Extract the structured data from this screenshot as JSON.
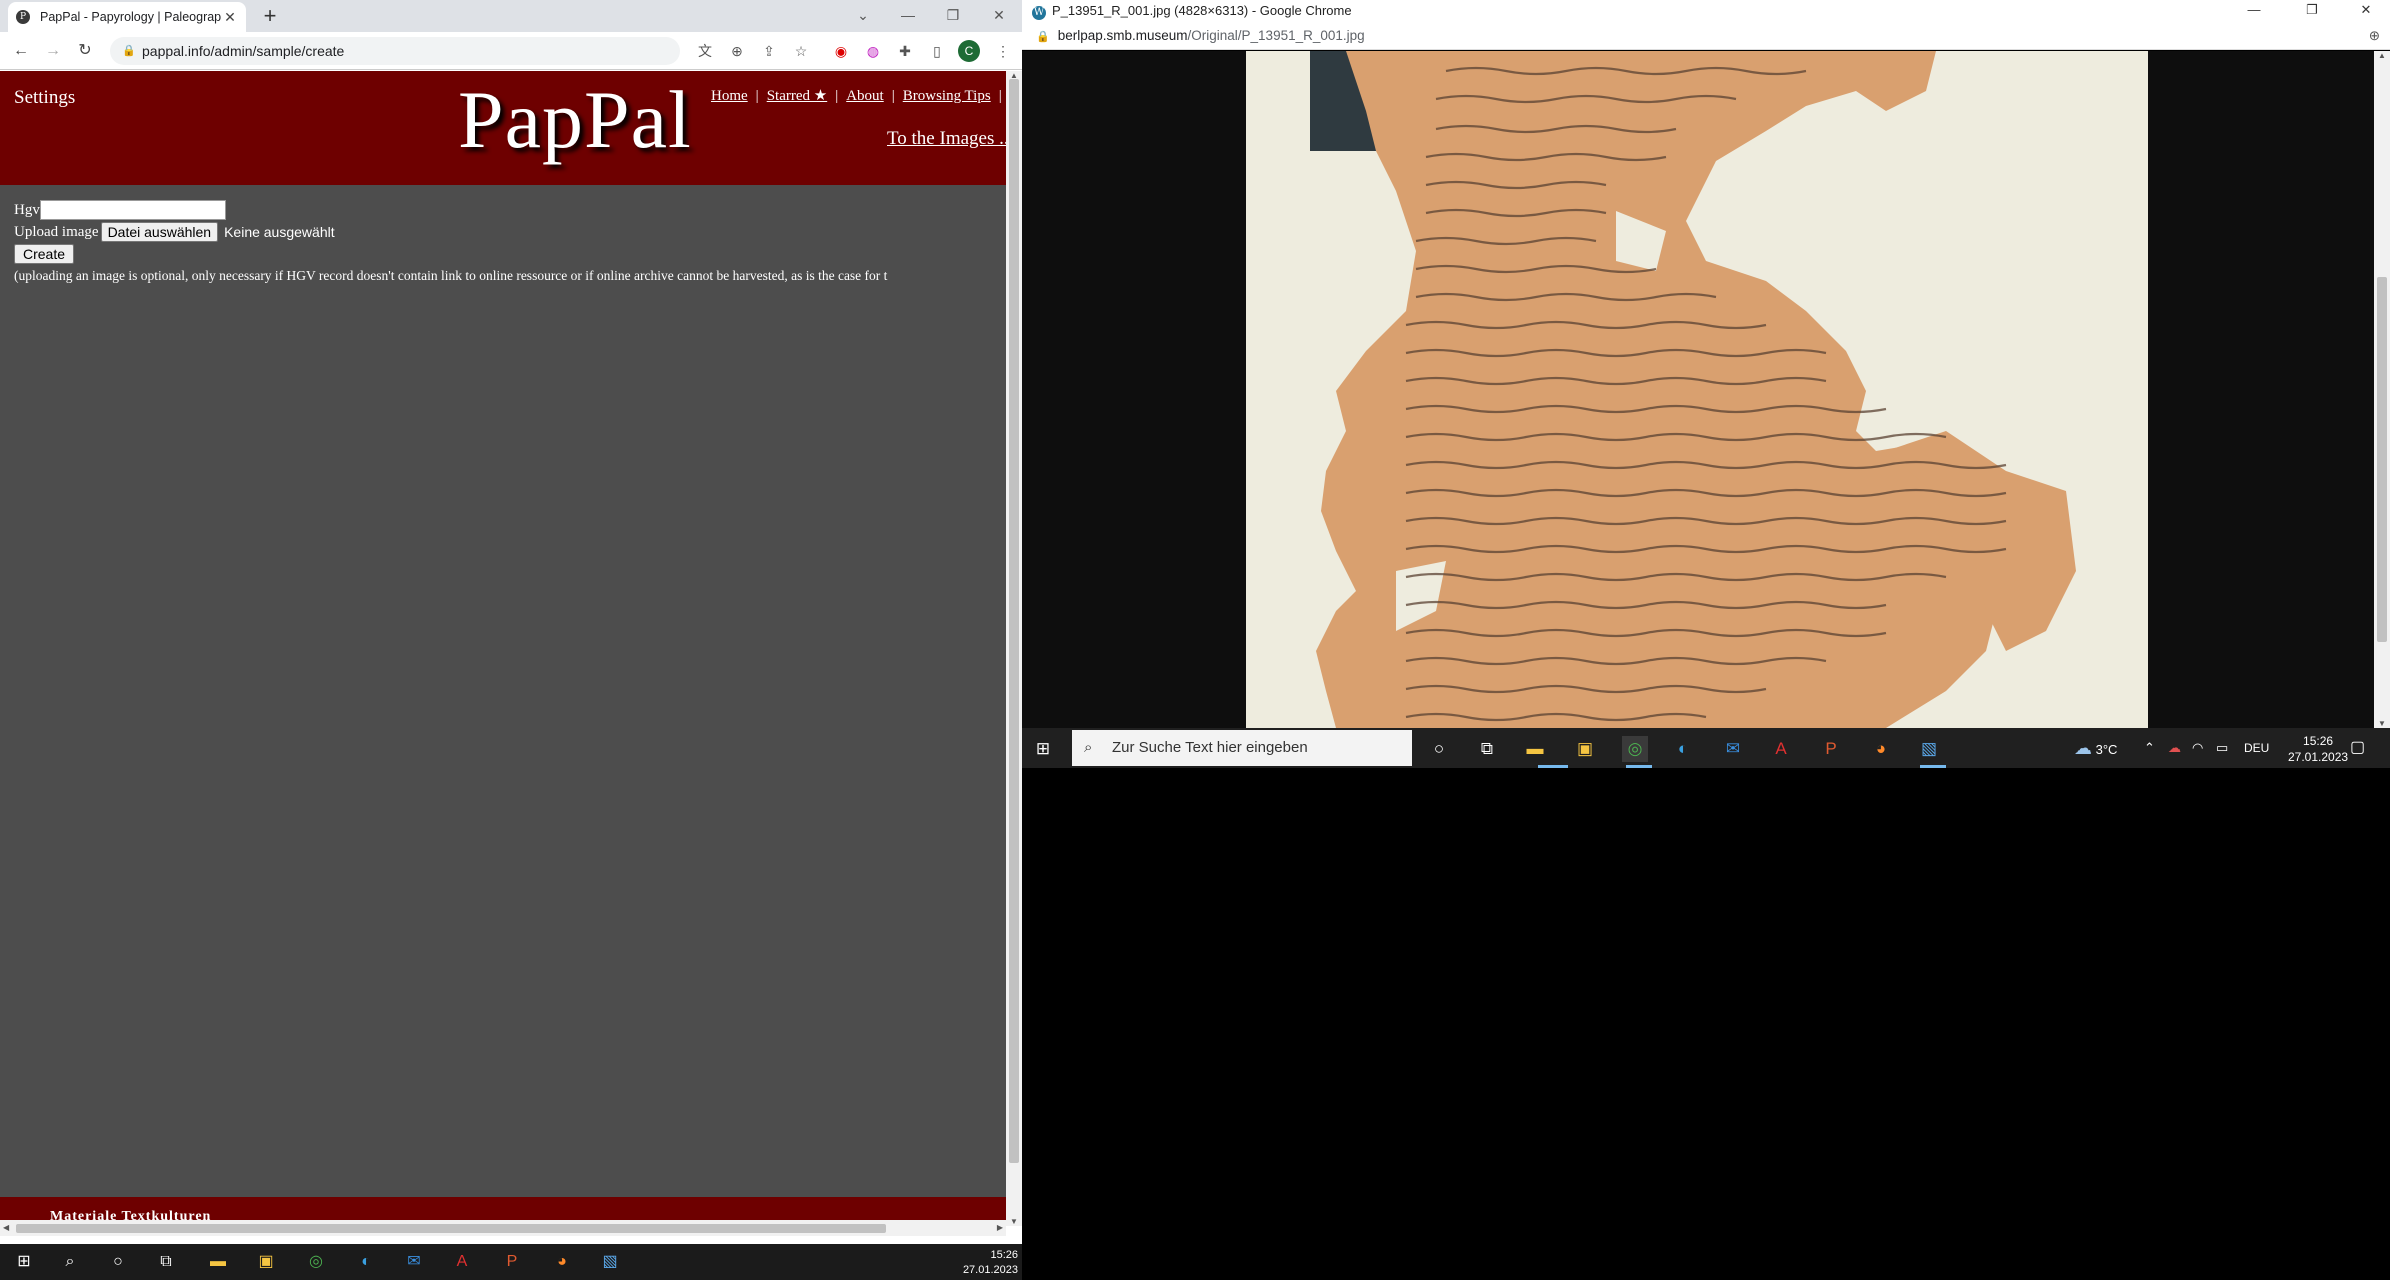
{
  "left_window": {
    "tab_title": "PapPal - Papyrology | Paleograph",
    "favicon_letter": "P",
    "url": "pappal.info/admin/sample/create",
    "avatar_letter": "C",
    "site": {
      "settings_label": "Settings",
      "logo": "PapPal",
      "nav": [
        "Home",
        "Starred ★",
        "About",
        "Browsing Tips"
      ],
      "nav_tail": "| ",
      "to_images": "To the Images ...",
      "form": {
        "hgv_label": "Hgv",
        "hgv_value": "",
        "upload_label": "Upload image",
        "file_button": "Datei auswählen",
        "file_status": "Keine ausgewählt",
        "create_button": "Create",
        "note": "(uploading an image is optional, only necessary if HGV record doesn't contain link to online ressource or if online archive cannot be harvested, as is the case for t"
      },
      "footer_text": "Materiale Textkulturen"
    },
    "taskbar": {
      "time": "15:26",
      "date": "27.01.2023"
    }
  },
  "right_window": {
    "title": "P_13951_R_001.jpg (4828×6313) - Google Chrome",
    "url_host": "berlpap.smb.museum",
    "url_path": "/Original/P_13951_R_001.jpg",
    "taskbar": {
      "search_placeholder": "Zur Suche Text hier eingeben",
      "weather": "3°C",
      "language": "DEU",
      "time": "15:26",
      "date": "27.01.2023"
    }
  },
  "colors": {
    "banner": "#6e0000",
    "page_bg": "#4d4d4d",
    "papyrus": "#d9a06f",
    "ink": "#4a3a30"
  }
}
